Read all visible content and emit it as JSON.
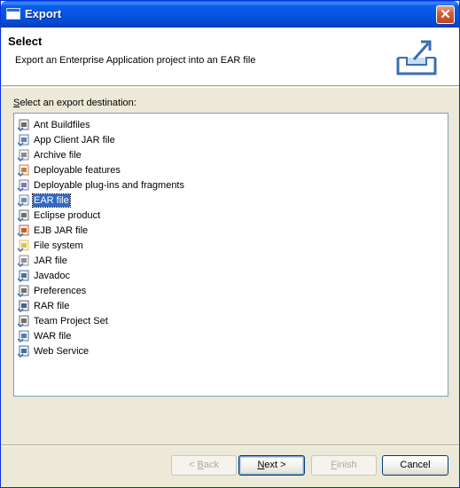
{
  "window": {
    "title": "Export"
  },
  "header": {
    "title": "Select",
    "description": "Export an Enterprise Application project into an EAR file"
  },
  "destination": {
    "label_pre": "",
    "label_mnemonic": "S",
    "label_post": "elect an export destination:"
  },
  "tree": {
    "items": [
      {
        "label": "Ant Buildfiles",
        "icon": "ant-icon",
        "color": "#6b6b6b"
      },
      {
        "label": "App Client JAR file",
        "icon": "app-client-jar-icon",
        "color": "#5a7fb5"
      },
      {
        "label": "Archive file",
        "icon": "archive-icon",
        "color": "#8a8a8a"
      },
      {
        "label": "Deployable features",
        "icon": "feature-icon",
        "color": "#c08040"
      },
      {
        "label": "Deployable plug-ins and fragments",
        "icon": "plugin-icon",
        "color": "#7a7ab0"
      },
      {
        "label": "EAR file",
        "icon": "ear-icon",
        "color": "#6b8fb5",
        "selected": true
      },
      {
        "label": "Eclipse product",
        "icon": "product-icon",
        "color": "#707070"
      },
      {
        "label": "EJB JAR file",
        "icon": "ejb-jar-icon",
        "color": "#c06030"
      },
      {
        "label": "File system",
        "icon": "folder-icon",
        "color": "#e8c050"
      },
      {
        "label": "JAR file",
        "icon": "jar-icon",
        "color": "#909090"
      },
      {
        "label": "Javadoc",
        "icon": "javadoc-icon",
        "color": "#5070a0"
      },
      {
        "label": "Preferences",
        "icon": "preferences-icon",
        "color": "#707070"
      },
      {
        "label": "RAR file",
        "icon": "rar-icon",
        "color": "#506080"
      },
      {
        "label": "Team Project Set",
        "icon": "team-icon",
        "color": "#707070"
      },
      {
        "label": "WAR file",
        "icon": "war-icon",
        "color": "#5080b0"
      },
      {
        "label": "Web Service",
        "icon": "web-service-icon",
        "color": "#4070a0"
      }
    ]
  },
  "buttons": {
    "back": {
      "pre": "< ",
      "mn": "B",
      "post": "ack"
    },
    "next": {
      "pre": "",
      "mn": "N",
      "post": "ext >"
    },
    "finish": {
      "pre": "",
      "mn": "F",
      "post": "inish"
    },
    "cancel": "Cancel"
  },
  "close_glyph": "✕"
}
